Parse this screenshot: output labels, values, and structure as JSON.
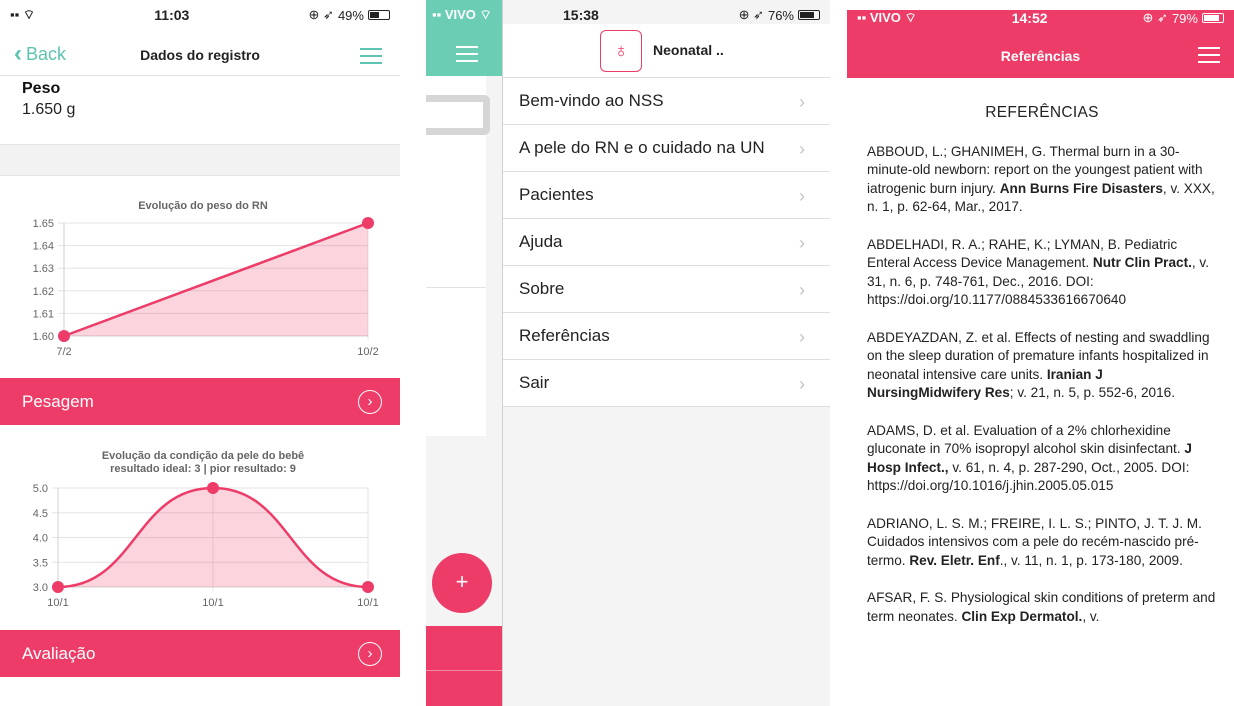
{
  "phone1": {
    "status": {
      "time": "11:03",
      "battery": "49%"
    },
    "nav": {
      "back_label": "Back",
      "title": "Dados do registro"
    },
    "weight": {
      "label": "Peso",
      "value": "1.650 g"
    },
    "weight_chart_title": "Evolução do peso do RN",
    "skin_chart_title_1": "Evolução da condição da pele do bebê",
    "skin_chart_title_2": "resultado ideal: 3 | pior resultado: 9",
    "pesagem_label": "Pesagem",
    "avaliacao_label": "Avaliação",
    "accent": "#ec3c67"
  },
  "chart_data": [
    {
      "type": "area",
      "title": "Evolução do peso do RN",
      "x": [
        "7/2",
        "10/2"
      ],
      "values": [
        1.6,
        1.65
      ],
      "yticks": [
        "1.65",
        "1.64",
        "1.63",
        "1.62",
        "1.61",
        "1.60"
      ],
      "ylim": [
        1.6,
        1.65
      ],
      "grid": true
    },
    {
      "type": "area",
      "title": "Evolução da condição da pele do bebê",
      "subtitle": "resultado ideal: 3 | pior resultado: 9",
      "x": [
        "10/1",
        "10/1",
        "10/1"
      ],
      "values": [
        3.0,
        5.0,
        3.0
      ],
      "yticks": [
        "5.0",
        "4.5",
        "4.0",
        "3.5",
        "3.0"
      ],
      "ylim": [
        3.0,
        5.0
      ],
      "grid": true
    }
  ],
  "phone2": {
    "status": {
      "carrier": "VIVO",
      "time": "15:38",
      "battery": "76%"
    },
    "app_name": "Neonatal ..",
    "fab_label": "+",
    "menu": [
      {
        "label": "Bem-vindo ao NSS"
      },
      {
        "label": "A pele do RN e o cuidado na UN"
      },
      {
        "label": "Pacientes"
      },
      {
        "label": "Ajuda"
      },
      {
        "label": "Sobre"
      },
      {
        "label": "Referências"
      },
      {
        "label": "Sair"
      }
    ]
  },
  "phone3": {
    "status": {
      "carrier": "VIVO",
      "time": "14:52",
      "battery": "79%"
    },
    "title": "Referências",
    "heading": "REFERÊNCIAS",
    "refs": [
      {
        "pre": "ABBOUD, L.; GHANIMEH, G. Thermal burn in a 30-minute-old newborn: report on the youngest patient with iatrogenic burn injury. ",
        "bold": "Ann Burns Fire Disasters",
        "post": ", v. XXX, n. 1, p. 62-64, Mar., 2017."
      },
      {
        "pre": "ABDELHADI, R. A.; RAHE, K.; LYMAN, B. Pediatric Enteral Access Device Management. ",
        "bold": "Nutr Clin Pract.",
        "post": ", v. 31, n. 6, p. 748-761, Dec., 2016. DOI: https://doi.org/10.1177/0884533616670640"
      },
      {
        "pre": "ABDEYAZDAN, Z. et al. Effects of nesting and swaddling on the sleep duration of premature infants hospitalized in neonatal intensive care units. ",
        "bold": "Iranian J NursingMidwifery Res",
        "post": "; v. 21, n. 5, p. 552-6, 2016."
      },
      {
        "pre": "ADAMS, D. et al. Evaluation of a 2% chlorhexidine gluconate in 70% isopropyl alcohol skin disinfectant. ",
        "bold": "J Hosp Infect.,",
        "post": " v. 61, n. 4, p. 287-290, Oct., 2005. DOI: https://doi.org/10.1016/j.jhin.2005.05.015"
      },
      {
        "pre": "ADRIANO, L. S. M.; FREIRE, I. L. S.; PINTO, J. T. J. M. Cuidados intensivos com a pele do recém-nascido pré-termo. ",
        "bold": "Rev. Eletr. Enf",
        "post": "., v. 11, n. 1, p. 173-180, 2009."
      },
      {
        "pre": "AFSAR, F. S. Physiological skin conditions of preterm and term neonates. ",
        "bold": "Clin Exp Dermatol.",
        "post": ", v."
      }
    ]
  }
}
